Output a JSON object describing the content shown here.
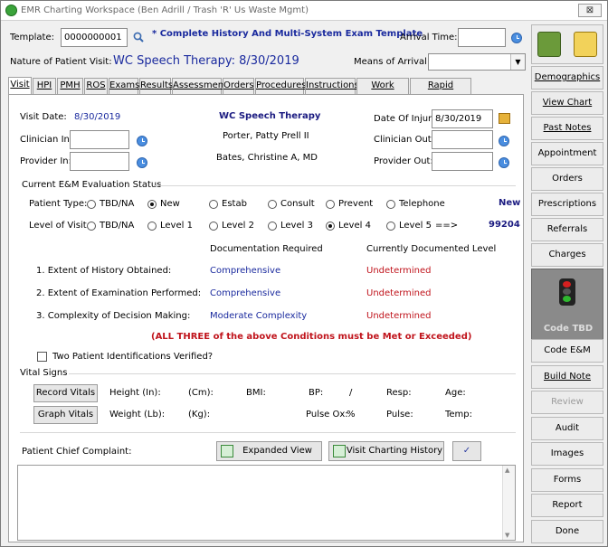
{
  "window": {
    "title": "EMR Charting Workspace (Ben Adrill / Trash 'R' Us Waste Mgmt)",
    "close_label": "⊠"
  },
  "header": {
    "template_label": "Template:",
    "template_value": "0000000001",
    "template_name": "* Complete History And Multi-System Exam Template",
    "arrival_time_label": "Arrival Time:",
    "arrival_time_value": "",
    "nature_label": "Nature of Patient Visit:",
    "nature_value": "WC Speech Therapy:  8/30/2019",
    "means_label": "Means of Arrival:",
    "means_value": ""
  },
  "tabs": [
    "Visit",
    "HPI",
    "PMH",
    "ROS",
    "Exams",
    "Results",
    "Assessment",
    "Orders",
    "Procedures",
    "Instructions",
    "Work Status",
    "Rapid Charting"
  ],
  "visit": {
    "visit_date_label": "Visit Date:",
    "visit_date_value": "8/30/2019",
    "visit_type": "WC Speech Therapy",
    "date_of_injury_label": "Date Of Injury:",
    "date_of_injury_value": "8/30/2019",
    "clinician_in_label": "Clinician In:",
    "clinician_name": "Porter, Patty Prell II",
    "clinician_out_label": "Clinician Out:",
    "provider_in_label": "Provider In:",
    "provider_name": "Bates, Christine A, MD",
    "provider_out_label": "Provider Out:"
  },
  "em": {
    "section_title": "Current E&M Evaluation Status",
    "patient_type_label": "Patient Type:",
    "patient_types": [
      "TBD/NA",
      "New",
      "Estab",
      "Consult",
      "Prevent",
      "Telephone"
    ],
    "patient_type_selected": "New",
    "patient_type_result": "New",
    "level_label": "Level of Visit:",
    "levels": [
      "TBD/NA",
      "Level 1",
      "Level 2",
      "Level 3",
      "Level 4",
      "Level 5"
    ],
    "level_selected": "Level 4",
    "level_arrow": "==>",
    "level_code": "99204",
    "doc_required_header": "Documentation Required",
    "doc_current_header": "Currently Documented Level",
    "rows": [
      {
        "label": "1.  Extent of History Obtained:",
        "required": "Comprehensive",
        "current": "Undetermined"
      },
      {
        "label": "2.  Extent of Examination Performed:",
        "required": "Comprehensive",
        "current": "Undetermined"
      },
      {
        "label": "3.  Complexity of Decision Making:",
        "required": "Moderate Complexity",
        "current": "Undetermined"
      }
    ],
    "conditions_note": "(ALL THREE of the above Conditions must be Met or Exceeded)"
  },
  "two_ids_label": "Two Patient Identifications Verified?",
  "vitals": {
    "section_title": "Vital Signs",
    "record_button": "Record Vitals",
    "graph_button": "Graph Vitals",
    "height_in": "Height  (In):",
    "height_cm": "(Cm):",
    "bmi": "BMI:",
    "bp": "BP:",
    "bp_sep": "/",
    "resp": "Resp:",
    "age": "Age:",
    "weight_lb": "Weight (Lb):",
    "weight_kg": "(Kg):",
    "pulse_ox": "Pulse Ox:",
    "pulse_ox_unit": "%",
    "pulse": "Pulse:",
    "temp": "Temp:"
  },
  "complaint": {
    "label": "Patient Chief Complaint:",
    "expanded_button": "Expanded View",
    "history_button": "Visit Charting History",
    "text": ""
  },
  "sidebar": {
    "items": [
      {
        "label": "Demographics",
        "underline": true
      },
      {
        "label": "View Chart",
        "underline": true
      },
      {
        "label": "Past Notes",
        "underline": true
      },
      {
        "label": "Appointment",
        "underline": false
      },
      {
        "label": "Orders",
        "underline": false
      },
      {
        "label": "Prescriptions",
        "underline": false
      },
      {
        "label": "Referrals",
        "underline": false
      },
      {
        "label": "Charges",
        "underline": false
      }
    ],
    "code_tbd": "Code TBD",
    "items2": [
      {
        "label": "Code E&M"
      },
      {
        "label": "Build Note"
      },
      {
        "label": "Review"
      },
      {
        "label": "Audit"
      },
      {
        "label": "Images"
      },
      {
        "label": "Forms"
      },
      {
        "label": "Report"
      },
      {
        "label": "Done"
      }
    ]
  },
  "colors": {
    "accent_blue": "#1a2a9e",
    "alert_red": "#c0141c",
    "code_bg": "#8a8a8a"
  }
}
